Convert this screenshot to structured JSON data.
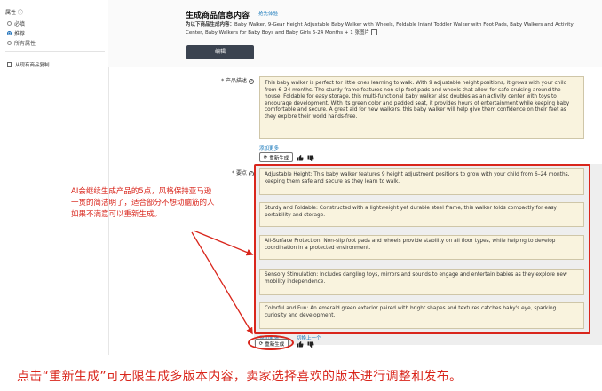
{
  "sidebar": {
    "attr_title": "属性 ⓘ",
    "options": [
      {
        "label": "必填",
        "selected": false
      },
      {
        "label": "推荐",
        "selected": true
      },
      {
        "label": "所有属性",
        "selected": false
      }
    ],
    "link_label": "从现有商品复制"
  },
  "header": {
    "title": "生成商品信息内容",
    "badge": "抢先体验",
    "desc_prefix": "为以下商品生成内容：",
    "desc_product": "Baby Walker, 9-Gear Height Adjustable Baby Walker with Wheels, Foldable Infant Toddler Walker with Foot Pads, Baby Walkers and Activity Center, Baby Walkers for Baby Boys and Baby Girls 6-24 Months",
    "desc_suffix": "+ 1 张图片 ",
    "edit_button": "编辑"
  },
  "product_description": {
    "label": "* 产品描述",
    "help_glyph": "?",
    "text": "This baby walker is perfect for little ones learning to walk. With 9 adjustable height positions, it grows with your child from 6–24 months. The sturdy frame features non-slip foot pads and wheels that allow for safe cruising around the house. Foldable for easy storage, this multi-functional baby walker also doubles as an activity center with toys to encourage development. With its green color and padded seat, it provides hours of entertainment while keeping baby comfortable and secure. A great aid for new walkers, this baby walker will help give them confidence on their feet as they explore their world hands-free.",
    "more_link": "添加更多",
    "regen_button": "重新生成"
  },
  "bullet_points": {
    "label": "* 要点",
    "help_glyph": "?",
    "items": [
      "Adjustable Height: This baby walker features 9 height adjustment positions to grow with your child from 6–24 months, keeping them safe and secure as they learn to walk.",
      "Sturdy and Foldable: Constructed with a lightweight yet durable steel frame, this walker folds compactly for easy portability and storage.",
      "All-Surface Protection: Non-slip foot pads and wheels provide stability on all floor types, while helping to develop coordination in a protected environment.",
      "Sensory Stimulation: Includes dangling toys, mirrors and sounds to engage and entertain babies as they explore new mobility independence.",
      "Colorful and Fun: An emerald green exterior paired with bright shapes and textures catches baby's eye, sparking curiosity and development."
    ],
    "more_link": "添加更多",
    "prev_link": "切换上一个",
    "regen_button": "重新生成"
  },
  "annotations": {
    "side_note": [
      "AI会继续生成产品的5点，风格保持亚马逊",
      "一贯的简洁明了，适合部分不想动脑筋的人",
      "如果不满意可以重新生成。"
    ],
    "footer_note": "点击“重新生成”可无限生成多版本内容，卖家选择喜欢的版本进行调整和发布。",
    "accent_color": "#d9261c"
  }
}
